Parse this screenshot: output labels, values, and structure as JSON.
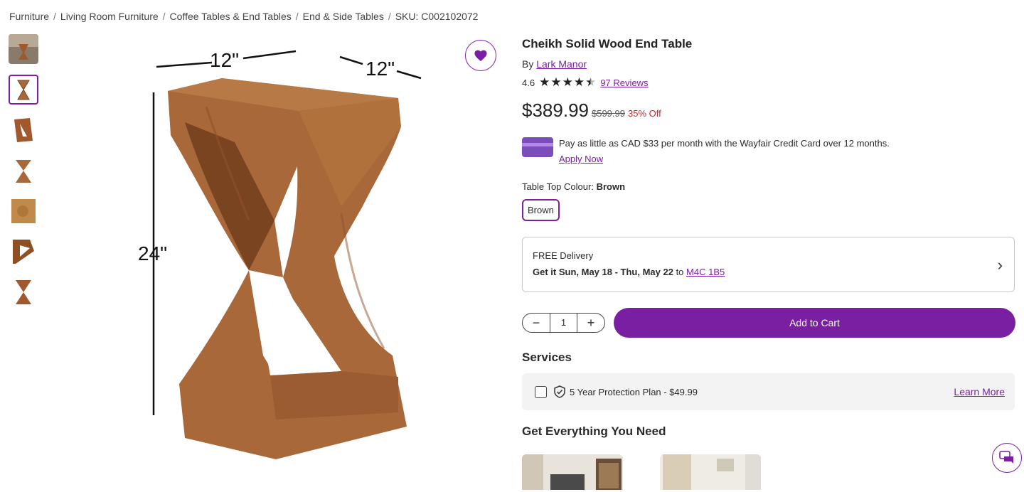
{
  "breadcrumb": {
    "items": [
      "Furniture",
      "Living Room Furniture",
      "Coffee Tables & End Tables",
      "End & Side Tables"
    ],
    "sku": "SKU: C002102072",
    "separator": "/"
  },
  "image": {
    "dim_top_left": "12\"",
    "dim_top_right": "12\"",
    "dim_height": "24\""
  },
  "product": {
    "title": "Cheikh Solid Wood End Table",
    "by_prefix": "By",
    "brand": "Lark Manor",
    "rating": "4.6",
    "rating_value": 4.6,
    "reviews": "97 Reviews",
    "price": "$389.99",
    "old_price": "$599.99",
    "discount": "35% Off"
  },
  "credit": {
    "text": "Pay as little as CAD $33 per month with the Wayfair Credit Card over 12 months.",
    "apply": "Apply Now"
  },
  "colour": {
    "label": "Table Top Colour:",
    "selected": "Brown",
    "swatch": "Brown"
  },
  "delivery": {
    "title": "FREE Delivery",
    "dates": "Get it Sun, May 18 - Thu, May 22",
    "to": "to",
    "postal": "M4C 1B5"
  },
  "cart": {
    "minus": "−",
    "qty": "1",
    "plus": "+",
    "add_to_cart": "Add to Cart"
  },
  "services": {
    "heading": "Services",
    "plan": "5 Year Protection Plan - $49.99",
    "learn_more": "Learn More"
  },
  "everything": {
    "heading": "Get Everything You Need"
  },
  "colors": {
    "accent": "#7b1fa2",
    "wood": "#a8683a",
    "sale": "#c62828"
  }
}
